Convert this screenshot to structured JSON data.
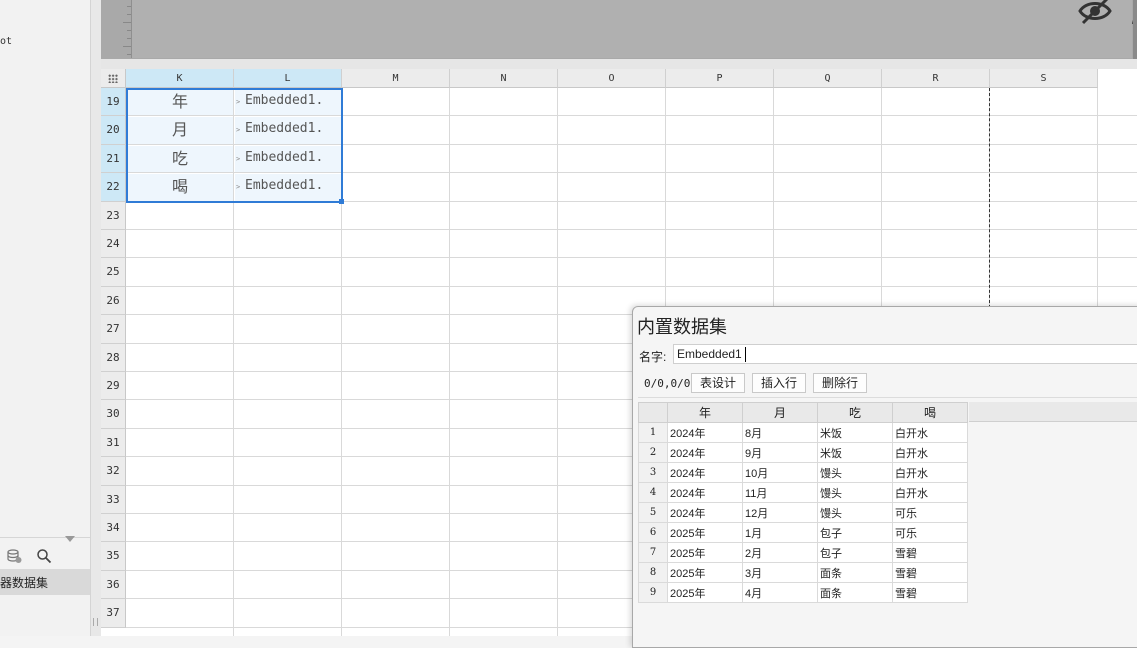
{
  "left_panel": {
    "top_text": "ot",
    "selected_item": "器数据集",
    "icons": [
      "database-icon",
      "search-icon"
    ]
  },
  "design_area": {
    "icons": [
      "hide-icon",
      "edit-icon"
    ]
  },
  "grid": {
    "columns": [
      "K",
      "L",
      "M",
      "N",
      "O",
      "P",
      "Q",
      "R",
      "S"
    ],
    "selected_columns": [
      "K",
      "L"
    ],
    "rows": [
      "19",
      "20",
      "21",
      "22",
      "23",
      "24",
      "25",
      "26",
      "27",
      "28",
      "29",
      "30",
      "31",
      "32",
      "33",
      "34",
      "35",
      "36",
      "37"
    ],
    "selected_rows": [
      "19",
      "20",
      "21",
      "22"
    ],
    "cells": [
      {
        "k": "年",
        "l": "Embedded1."
      },
      {
        "k": "月",
        "l": "Embedded1."
      },
      {
        "k": "吃",
        "l": "Embedded1."
      },
      {
        "k": "喝",
        "l": "Embedded1."
      }
    ],
    "selection_color": "#2f7bd6"
  },
  "dialog": {
    "title": "内置数据集",
    "name_label": "名字:",
    "name_value": "Embedded1",
    "counter": "0/0,0/0",
    "buttons": {
      "design": "表设计",
      "insert_row": "插入行",
      "delete_row": "删除行"
    },
    "table": {
      "headers": [
        "年",
        "月",
        "吃",
        "喝"
      ],
      "rows": [
        [
          "1",
          "2024年",
          "8月",
          "米饭",
          "白开水"
        ],
        [
          "2",
          "2024年",
          "9月",
          "米饭",
          "白开水"
        ],
        [
          "3",
          "2024年",
          "10月",
          "馒头",
          "白开水"
        ],
        [
          "4",
          "2024年",
          "11月",
          "馒头",
          "白开水"
        ],
        [
          "5",
          "2024年",
          "12月",
          "馒头",
          "可乐"
        ],
        [
          "6",
          "2025年",
          "1月",
          "包子",
          "可乐"
        ],
        [
          "7",
          "2025年",
          "2月",
          "包子",
          "雪碧"
        ],
        [
          "8",
          "2025年",
          "3月",
          "面条",
          "雪碧"
        ],
        [
          "9",
          "2025年",
          "4月",
          "面条",
          "雪碧"
        ]
      ]
    }
  }
}
